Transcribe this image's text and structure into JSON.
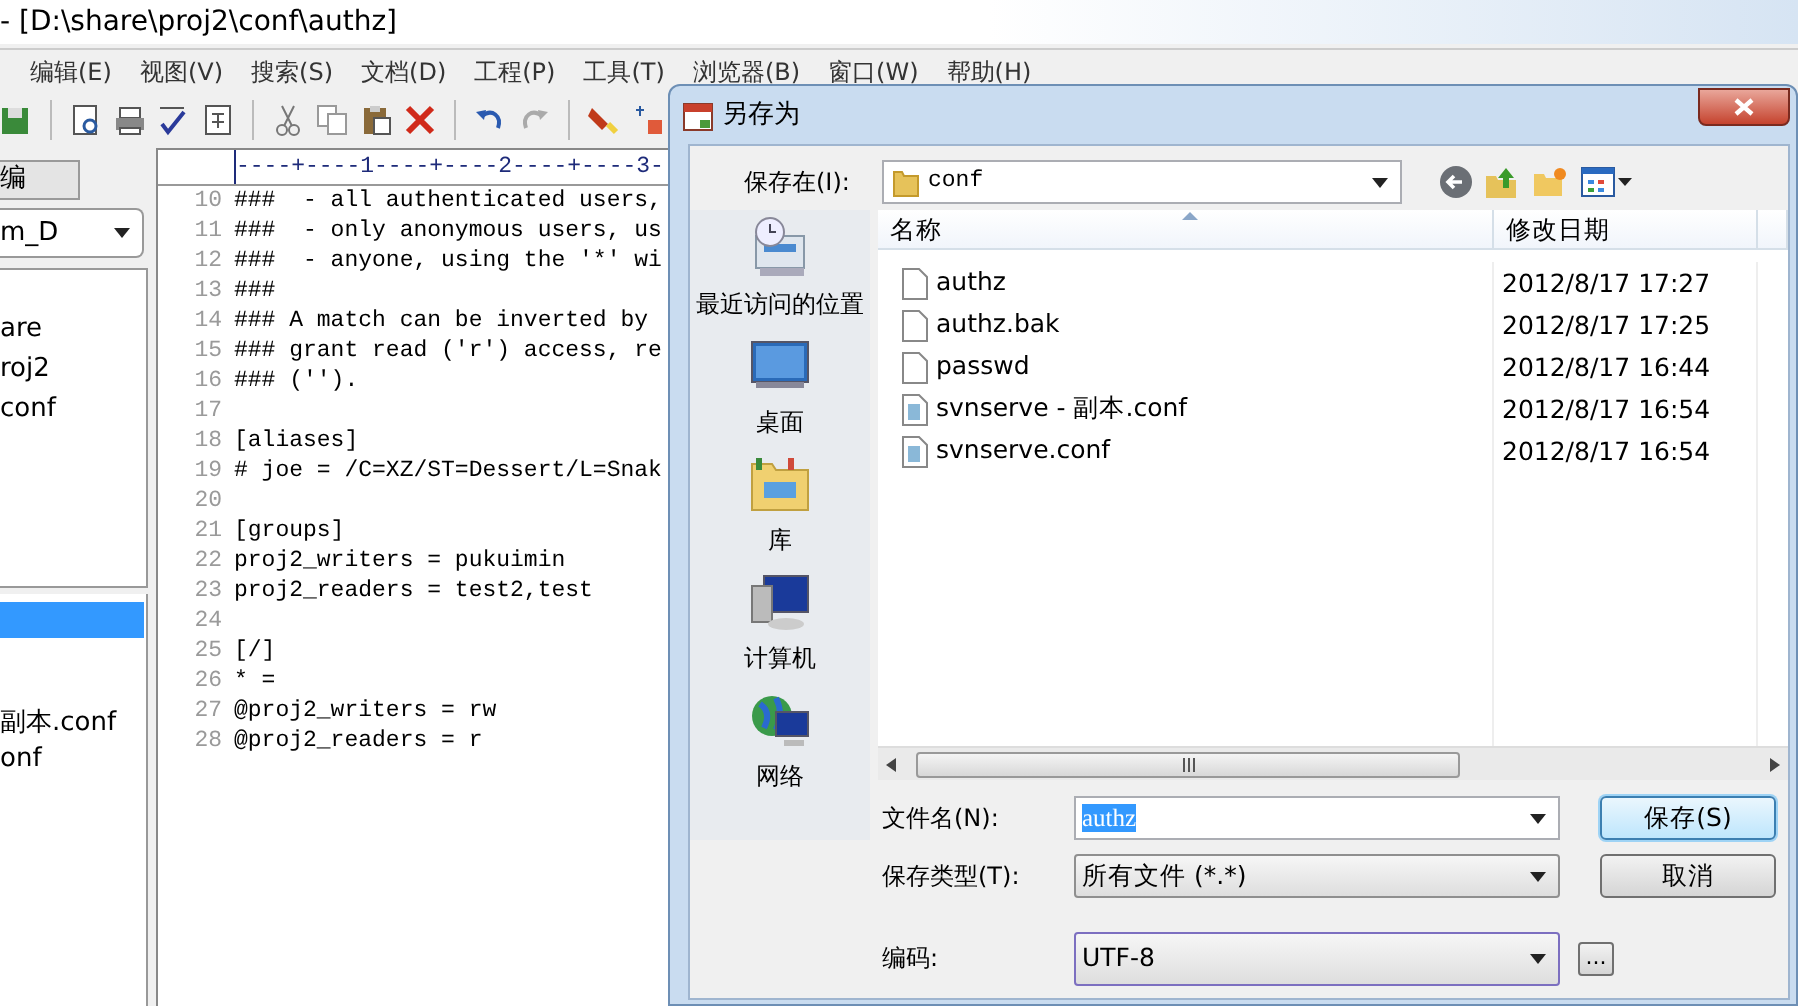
{
  "app": {
    "title": "- [D:\\share\\proj2\\conf\\authz]",
    "menu": [
      "编辑(E)",
      "视图(V)",
      "搜索(S)",
      "文档(D)",
      "工程(P)",
      "工具(T)",
      "浏览器(B)",
      "窗口(W)",
      "帮助(H)"
    ],
    "side_tab": "编",
    "drive_select": "m_D",
    "tree": [
      "are",
      "roj2",
      "conf"
    ],
    "files": [
      {
        "selected": true
      },
      {
        "name": "副本.conf",
        "selected": false
      },
      {
        "name": "onf",
        "selected": false
      }
    ],
    "editor": {
      "ruler": "----+----1----+----2----+----3-",
      "lines": [
        {
          "number": "10",
          "text": "###  - all authenticated users,"
        },
        {
          "number": "11",
          "text": "###  - only anonymous users, us"
        },
        {
          "number": "12",
          "text": "###  - anyone, using the '*' wi"
        },
        {
          "number": "13",
          "text": "###"
        },
        {
          "number": "14",
          "text": "### A match can be inverted by"
        },
        {
          "number": "15",
          "text": "### grant read ('r') access, re"
        },
        {
          "number": "16",
          "text": "### ('')."
        },
        {
          "number": "17"
        },
        {
          "number": "18",
          "text": "[aliases]"
        },
        {
          "number": "19",
          "text": "# joe = /C=XZ/ST=Dessert/L=Snak"
        },
        {
          "number": "20"
        },
        {
          "number": "21",
          "text": "[groups]"
        },
        {
          "number": "22",
          "text": "proj2_writers = pukuimin"
        },
        {
          "number": "23",
          "text": "proj2_readers = test2,test"
        },
        {
          "number": "24"
        },
        {
          "number": "25",
          "text": "[/]"
        },
        {
          "number": "26",
          "text": "* ="
        },
        {
          "number": "27",
          "text": "@proj2_writers = rw"
        },
        {
          "number": "28",
          "text": "@proj2_readers = r"
        }
      ]
    }
  },
  "dialog": {
    "title": "另存为",
    "save_in": {
      "label": "保存在(I):",
      "value": "conf"
    },
    "places": [
      {
        "label": "最近访问的位置",
        "kind": "recent"
      },
      {
        "label": "桌面",
        "kind": "desktop"
      },
      {
        "label": "库",
        "kind": "library"
      },
      {
        "label": "计算机",
        "kind": "computer"
      },
      {
        "label": "网络",
        "kind": "network"
      }
    ],
    "columns": [
      "名称",
      "修改日期"
    ],
    "files": [
      {
        "name": "authz",
        "modified": "2012/8/17 17:27",
        "kind": "plain"
      },
      {
        "name": "authz.bak",
        "modified": "2012/8/17 17:25",
        "kind": "plain"
      },
      {
        "name": "passwd",
        "modified": "2012/8/17 16:44",
        "kind": "plain"
      },
      {
        "name": "svnserve - 副本.conf",
        "modified": "2012/8/17 16:54",
        "kind": "conf"
      },
      {
        "name": "svnserve.conf",
        "modified": "2012/8/17 16:54",
        "kind": "conf"
      }
    ],
    "file_name": {
      "label": "文件名(N):",
      "value": "authz",
      "selected": true
    },
    "file_type": {
      "label": "保存类型(T):",
      "value": "所有文件 (*.*)"
    },
    "encoding": {
      "label": "编码:",
      "value": "UTF-8"
    },
    "buttons": [
      {
        "label": "保存(S)",
        "default": true
      },
      {
        "label": "取消",
        "default": false
      }
    ],
    "more_button": "..."
  }
}
